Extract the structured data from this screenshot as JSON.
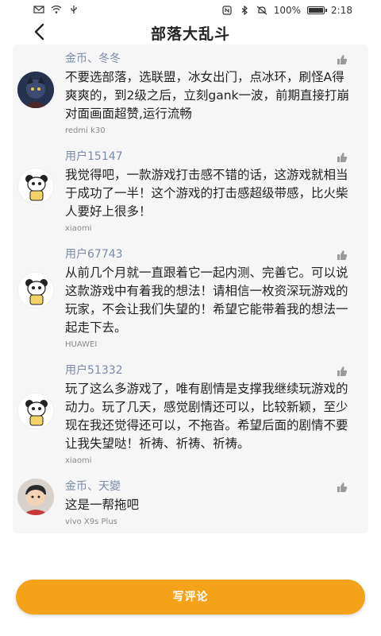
{
  "status_bar": {
    "battery": "100%",
    "battery_level": 1.0,
    "time": "2:18"
  },
  "header": {
    "title": "部落大乱斗"
  },
  "comments": [
    {
      "name": "金币、冬冬",
      "text": "不要选部落，选联盟，冰女出门，点冰环，刷怪A得爽爽的，到2级之后，立刻gank一波，前期直接打崩对面画面超赞,运行流畅",
      "device": "redmi k30"
    },
    {
      "name": "用户15147",
      "text": "我觉得吧，一款游戏打击感不错的话，这游戏就相当于成功了一半！这个游戏的打击感超级带感，比火柴人要好上很多！",
      "device": "xiaomi"
    },
    {
      "name": "用户67743",
      "text": "从前几个月就一直跟着它一起内测、完善它。可以说这款游戏中有着我的想法！请相信一枚资深玩游戏的玩家，不会让我们失望的！希望它能带着我的想法一起走下去。",
      "device": "HUAWEI"
    },
    {
      "name": "用户51332",
      "text": "玩了这么多游戏了，唯有剧情是支撑我继续玩游戏的动力。玩了几天，感觉剧情还可以，比较新颖，至少现在我还觉得还可以，不拖沓。希望后面的剧情不要让我失望哒！祈祷、祈祷、祈祷。",
      "device": "xiaomi"
    },
    {
      "name": "金币、天變",
      "text": "这是一帮拖吧",
      "device": "vivo X9s Plus"
    }
  ],
  "write_button": {
    "label": "写评论",
    "color": "#f4a21a"
  }
}
